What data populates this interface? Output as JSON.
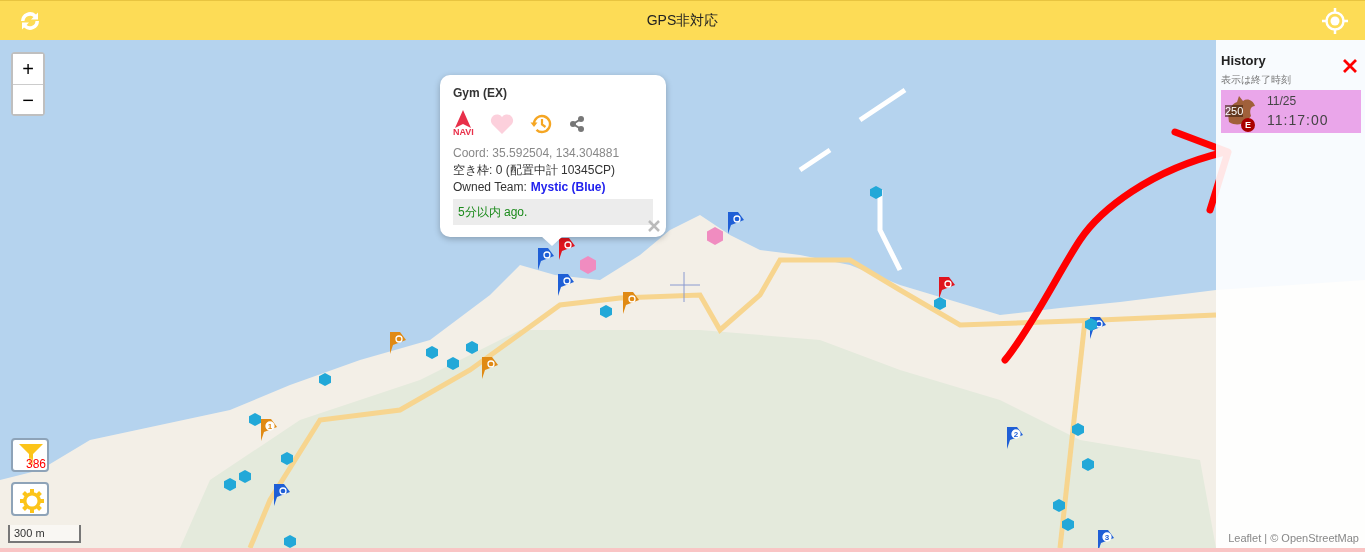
{
  "header": {
    "title": "GPS非対応"
  },
  "map": {
    "zoom_in": "+",
    "zoom_out": "−",
    "filter_count": "386",
    "scale": "300 m",
    "attribution": "Leaflet | © OpenStreetMap",
    "markers": [
      {
        "kind": "gym",
        "color": "#1f5fd6"
      },
      {
        "kind": "gym",
        "color": "#1f5fd6"
      },
      {
        "kind": "gym",
        "color": "#1f5fd6"
      },
      {
        "kind": "gym",
        "color": "#1f5fd6"
      },
      {
        "kind": "gym",
        "color": "#1f5fd6",
        "label": "2"
      },
      {
        "kind": "gym",
        "color": "#1f5fd6",
        "label": "3"
      },
      {
        "kind": "gym",
        "color": "#1f5fd6"
      },
      {
        "kind": "gym",
        "color": "#e0141e"
      },
      {
        "kind": "gym",
        "color": "#e0141e"
      },
      {
        "kind": "gym",
        "color": "#e08a14"
      },
      {
        "kind": "gym",
        "color": "#e08a14"
      },
      {
        "kind": "gym",
        "color": "#e08a14"
      },
      {
        "kind": "gym",
        "color": "#e08a14",
        "label": "1"
      },
      {
        "kind": "lure",
        "color": "#f08cc0"
      },
      {
        "kind": "lure",
        "color": "#f08cc0"
      },
      {
        "kind": "stop",
        "color": "#22a8d8"
      },
      {
        "kind": "stop",
        "color": "#22a8d8"
      },
      {
        "kind": "stop",
        "color": "#22a8d8"
      },
      {
        "kind": "stop",
        "color": "#22a8d8"
      },
      {
        "kind": "stop",
        "color": "#22a8d8"
      },
      {
        "kind": "stop",
        "color": "#22a8d8"
      },
      {
        "kind": "stop",
        "color": "#22a8d8"
      },
      {
        "kind": "stop",
        "color": "#22a8d8"
      },
      {
        "kind": "stop",
        "color": "#22a8d8"
      },
      {
        "kind": "stop",
        "color": "#22a8d8"
      },
      {
        "kind": "stop",
        "color": "#22a8d8"
      },
      {
        "kind": "stop",
        "color": "#22a8d8"
      },
      {
        "kind": "stop",
        "color": "#22a8d8"
      },
      {
        "kind": "stop",
        "color": "#22a8d8"
      },
      {
        "kind": "stop",
        "color": "#22a8d8"
      },
      {
        "kind": "stop",
        "color": "#22a8d8"
      },
      {
        "kind": "stop",
        "color": "#22a8d8"
      }
    ]
  },
  "popup": {
    "title": "Gym (EX)",
    "nav_label": "NAVI",
    "coord": "Coord: 35.592504, 134.304881",
    "slots": "空き枠: 0 (配置中計 10345CP)",
    "team_label": "Owned Team:",
    "team": "Mystic (Blue)",
    "updated": "5分以内 ago."
  },
  "history": {
    "title": "History",
    "subtitle": "表示は終了時刻",
    "entries": [
      {
        "cp": "250",
        "badge": "E",
        "date": "11/25",
        "time": "11:17:00"
      }
    ]
  }
}
